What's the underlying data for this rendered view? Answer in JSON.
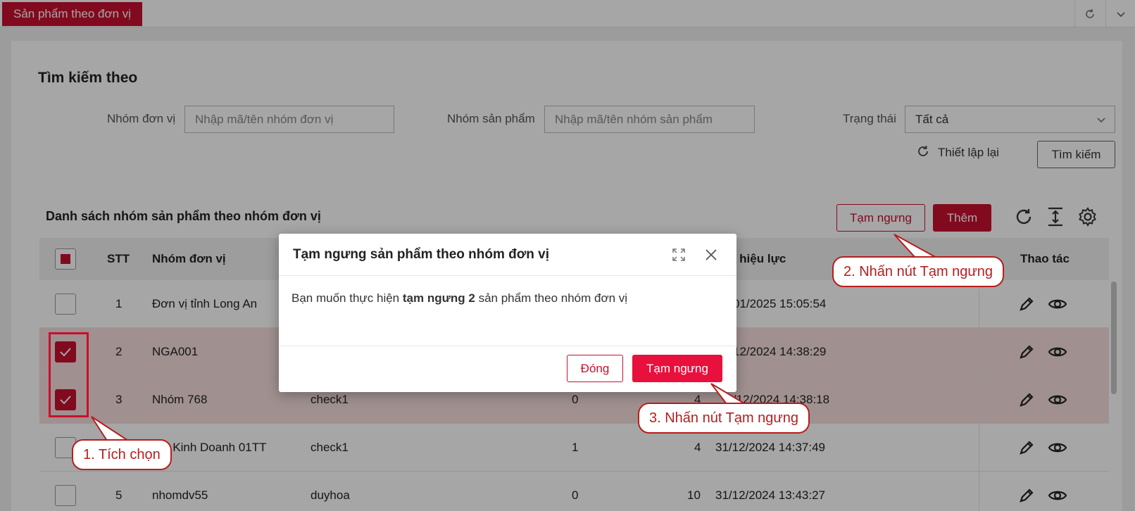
{
  "topbar": {
    "tab_label": "Sản phẩm theo đơn vị"
  },
  "search": {
    "title": "Tìm kiếm theo",
    "unit_group_label": "Nhóm đơn vị",
    "unit_group_placeholder": "Nhập mã/tên nhóm đơn vị",
    "product_group_label": "Nhóm sản phẩm",
    "product_group_placeholder": "Nhập mã/tên nhóm sản phẩm",
    "status_label": "Trạng thái",
    "status_value": "Tất cả",
    "reset_label": "Thiết lập lại",
    "search_label": "Tìm kiếm"
  },
  "list": {
    "title": "Danh sách nhóm sản phẩm theo nhóm đơn vị",
    "suspend_label": "Tạm ngưng",
    "add_label": "Thêm"
  },
  "table": {
    "headers": {
      "stt": "STT",
      "unit_group": "Nhóm đơn vị",
      "effective_date": "y hiệu lực",
      "actions": "Thao tác"
    },
    "rows": [
      {
        "stt": "1",
        "unit_group": "Đơn vị tỉnh Long An",
        "product_group": "",
        "c1": "",
        "c2": "",
        "date": "01/2025 15:05:54",
        "checked": false
      },
      {
        "stt": "2",
        "unit_group": "NGA001",
        "product_group": "",
        "c1": "",
        "c2": "",
        "date": "12/2024 14:38:29",
        "checked": true
      },
      {
        "stt": "3",
        "unit_group": "Nhóm 768",
        "product_group": "check1",
        "c1": "0",
        "c2": "4",
        "date": "/12/2024 14:38:18",
        "checked": true
      },
      {
        "stt": "",
        "unit_group": "m - Kinh Doanh 01TT",
        "product_group": "check1",
        "c1": "1",
        "c2": "4",
        "date": "31/12/2024 14:37:49",
        "checked": false
      },
      {
        "stt": "5",
        "unit_group": "nhomdv55",
        "product_group": "duyhoa",
        "c1": "0",
        "c2": "10",
        "date": "31/12/2024 13:43:27",
        "checked": false
      }
    ]
  },
  "modal": {
    "title": "Tạm ngưng sản phẩm theo nhóm đơn vị",
    "body_prefix": "Bạn muốn thực hiện ",
    "body_bold": "tạm ngưng 2",
    "body_suffix": " sản phẩm theo nhóm đơn vị",
    "close_label": "Đóng",
    "confirm_label": "Tạm ngưng"
  },
  "callouts": {
    "step1": "1. Tích chọn",
    "step2": "2. Nhấn nút Tạm ngưng",
    "step3": "3. Nhấn nút Tạm ngưng"
  },
  "colors": {
    "brand": "#c8102e",
    "confirm": "#e8103c",
    "callout": "#b81d1d"
  }
}
